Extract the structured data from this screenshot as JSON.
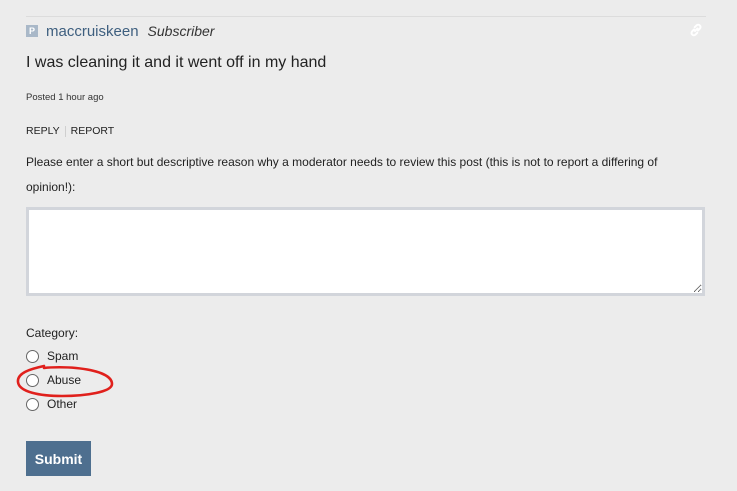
{
  "post": {
    "avatar_letter": "P",
    "username": "maccruiskeen",
    "role": "Subscriber",
    "body": "I was cleaning it and it went off in my hand",
    "posted": "Posted 1 hour ago",
    "link_icon": "link-icon"
  },
  "actions": {
    "reply_label": "REPLY",
    "report_label": "REPORT"
  },
  "report_form": {
    "prompt": "Please enter a short but descriptive reason why a moderator needs to review this post (this is not to report a differing of opinion!):",
    "reason_value": "",
    "category_label": "Category:",
    "categories": [
      {
        "label": "Spam",
        "selected": false
      },
      {
        "label": "Abuse",
        "selected": false
      },
      {
        "label": "Other",
        "selected": false
      }
    ],
    "submit_label": "Submit"
  },
  "colors": {
    "background": "#ececec",
    "username": "#3e5f7f",
    "submit_bg": "#4e6f8f",
    "annotation": "#e0201c"
  }
}
